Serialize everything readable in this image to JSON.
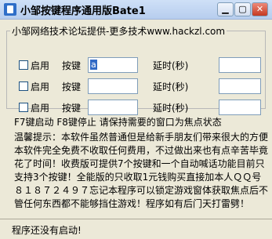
{
  "window": {
    "title": "小邹按键程序通用版Bate1"
  },
  "group": {
    "title": "小邹网络技术论坛提供-更多技术www.hackzl.com"
  },
  "rows": [
    {
      "enable_label": "启用",
      "key_label": "按键",
      "key_value": "a",
      "delay_label": "延时(秒)",
      "delay_value": ""
    },
    {
      "enable_label": "启用",
      "key_label": "按键",
      "key_value": "",
      "delay_label": "延时(秒)",
      "delay_value": ""
    },
    {
      "enable_label": "启用",
      "key_label": "按键",
      "key_value": "",
      "delay_label": "延时(秒)",
      "delay_value": ""
    }
  ],
  "hint": "F7键启动  F8键停止   请保持需要的窗口为焦点状态",
  "notice": "温馨提示：本软件虽然普通但是给新手朋友们带来很大的方便本软件完全免费不收取任何费用，不过做出来也有点辛苦毕竟花了时间！收费版可提供7个按键和一个自动喊话功能目前只支持3个按键！全能版的只收取1元钱购买直接加本人ＱＱ号８１８７２４９７忘记本程序可以锁定游戏窗体获取焦点后不管任何东西都不能够挡住游戏！程序如有后门天打雷劈！",
  "status": "程序还没有启动!"
}
